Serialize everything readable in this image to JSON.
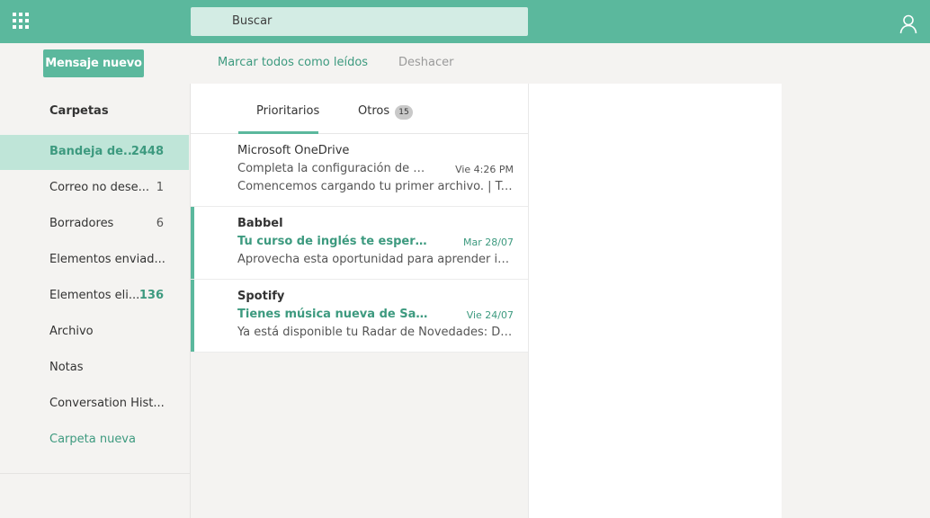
{
  "topbar": {
    "search_placeholder": "Buscar",
    "accent_color": "#5bb89d"
  },
  "actions": {
    "new_message": "Mensaje nuevo",
    "mark_all_read": "Marcar todos como leídos",
    "undo": "Deshacer"
  },
  "sidebar": {
    "heading": "Carpetas",
    "folders": [
      {
        "label": "Bandeja de...",
        "count": "2448"
      },
      {
        "label": "Correo no dese...",
        "count": "1"
      },
      {
        "label": "Borradores",
        "count": "6"
      },
      {
        "label": "Elementos enviad...",
        "count": ""
      },
      {
        "label": "Elementos eli...",
        "count": "136"
      },
      {
        "label": "Archivo",
        "count": ""
      },
      {
        "label": "Notas",
        "count": ""
      },
      {
        "label": "Conversation Hist...",
        "count": ""
      }
    ],
    "new_folder": "Carpeta nueva"
  },
  "tabs": {
    "focused": "Prioritarios",
    "other": "Otros",
    "other_count": "15"
  },
  "messages": [
    {
      "sender": "Microsoft OneDrive",
      "subject": "Completa la configuración de OneDrive",
      "date": "Vie 4:26 PM",
      "preview": "Comencemos cargando tu primer archivo. | Tu OneDrive",
      "unread": false
    },
    {
      "sender": "Babbel",
      "subject": "Tu curso de inglés te espera, ahora",
      "date": "Mar 28/07",
      "preview": "Aprovecha esta oportunidad para aprender inglés",
      "unread": true
    },
    {
      "sender": "Spotify",
      "subject": "Tienes música nueva de Santiago",
      "date": "Vie 24/07",
      "preview": "Ya está disponible tu Radar de Novedades: Disfrútalo",
      "unread": true
    }
  ]
}
